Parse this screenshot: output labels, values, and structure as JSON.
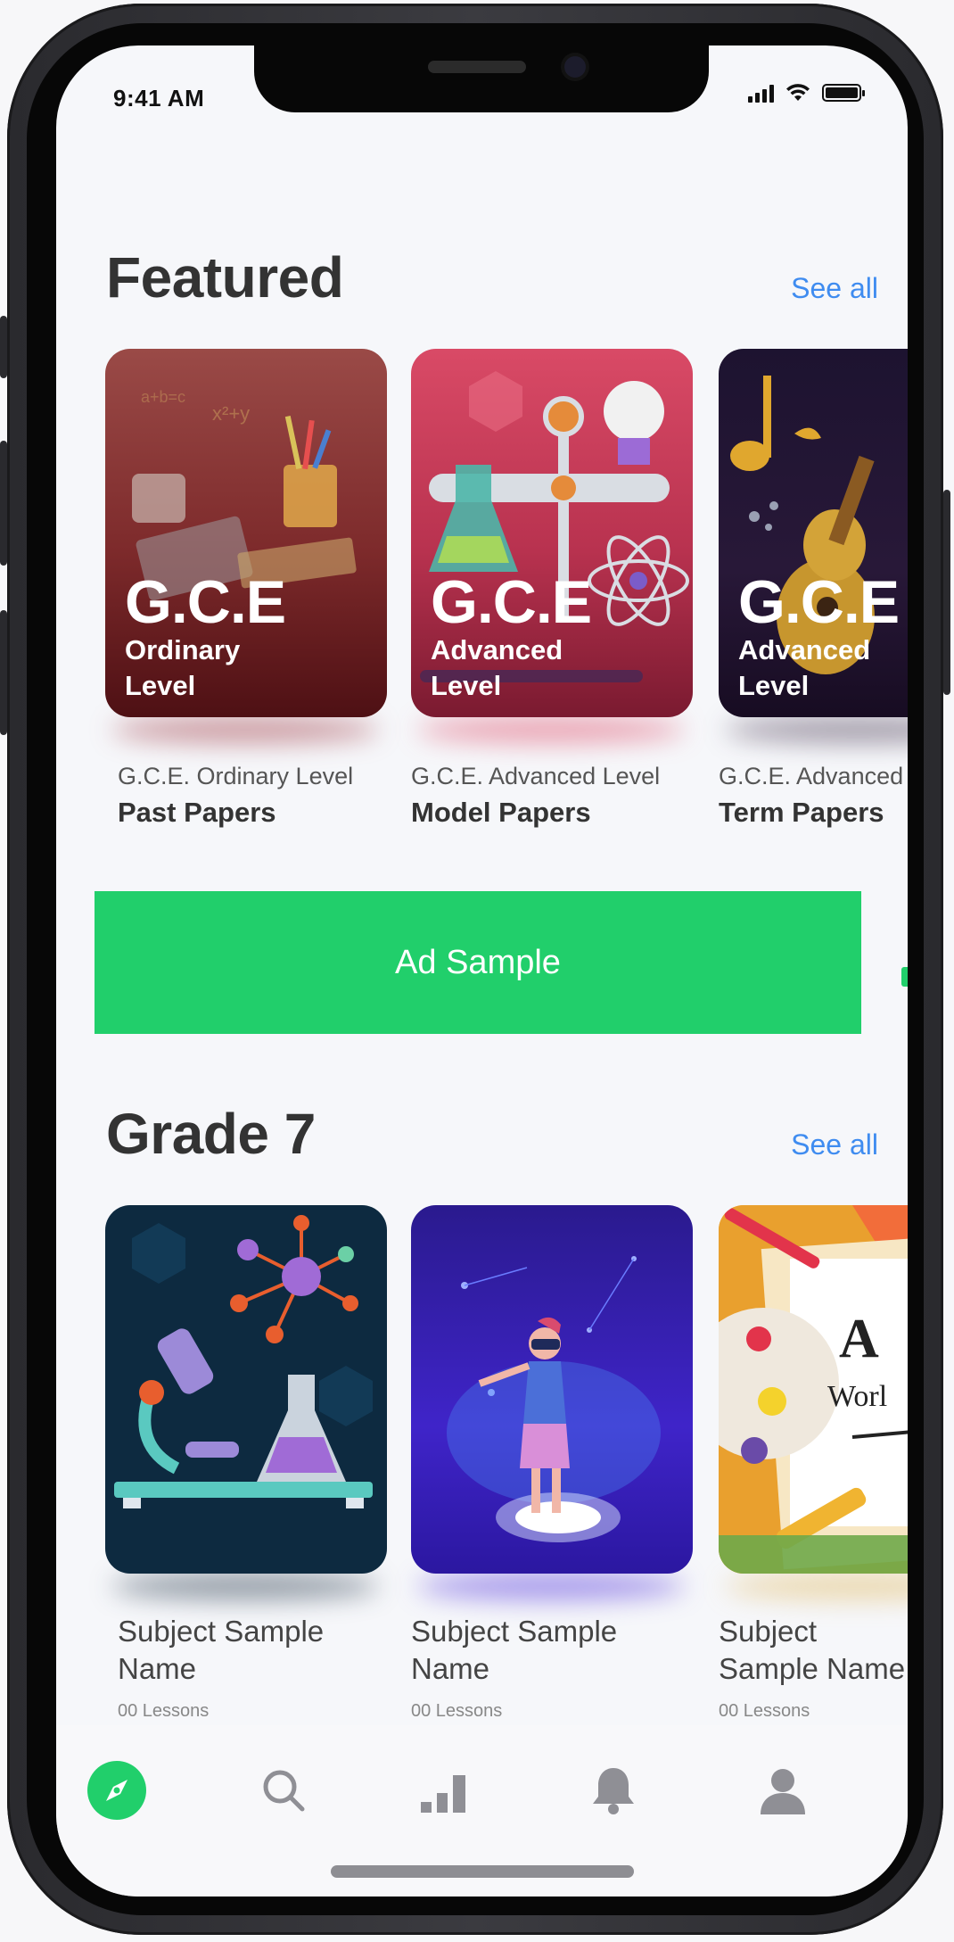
{
  "status_bar": {
    "time": "9:41 AM"
  },
  "featured": {
    "title": "Featured",
    "see_all": "See all",
    "cards": [
      {
        "badge_big": "G.C.E",
        "badge_small": "Ordinary Level",
        "subtitle": "G.C.E. Ordinary Level",
        "name": "Past Papers"
      },
      {
        "badge_big": "G.C.E",
        "badge_small": "Advanced Level",
        "subtitle": "G.C.E. Advanced Level",
        "name": "Model Papers"
      },
      {
        "badge_big": "G.C.E",
        "badge_small": "Advanced Level",
        "subtitle": "G.C.E. Advanced Level",
        "name": "Term Papers"
      }
    ]
  },
  "ad": {
    "label": "Ad Sample",
    "color": "#21cf6b"
  },
  "grade": {
    "title": "Grade 7",
    "see_all": "See all",
    "cards": [
      {
        "name": "Subject Sample Name",
        "lessons": "00 Lessons"
      },
      {
        "name": "Subject Sample Name",
        "lessons": "00 Lessons"
      },
      {
        "name": "Subject Sample Name",
        "lessons": "00 Lessons",
        "art_text_1": "A",
        "art_text_2": "Worl"
      }
    ]
  },
  "tab_bar": {
    "items": [
      "compass-icon",
      "search-icon",
      "stats-icon",
      "bell-icon",
      "profile-icon"
    ],
    "active": "compass-icon"
  },
  "colors": {
    "accent": "#3f8cf0",
    "green": "#21cf6b"
  }
}
